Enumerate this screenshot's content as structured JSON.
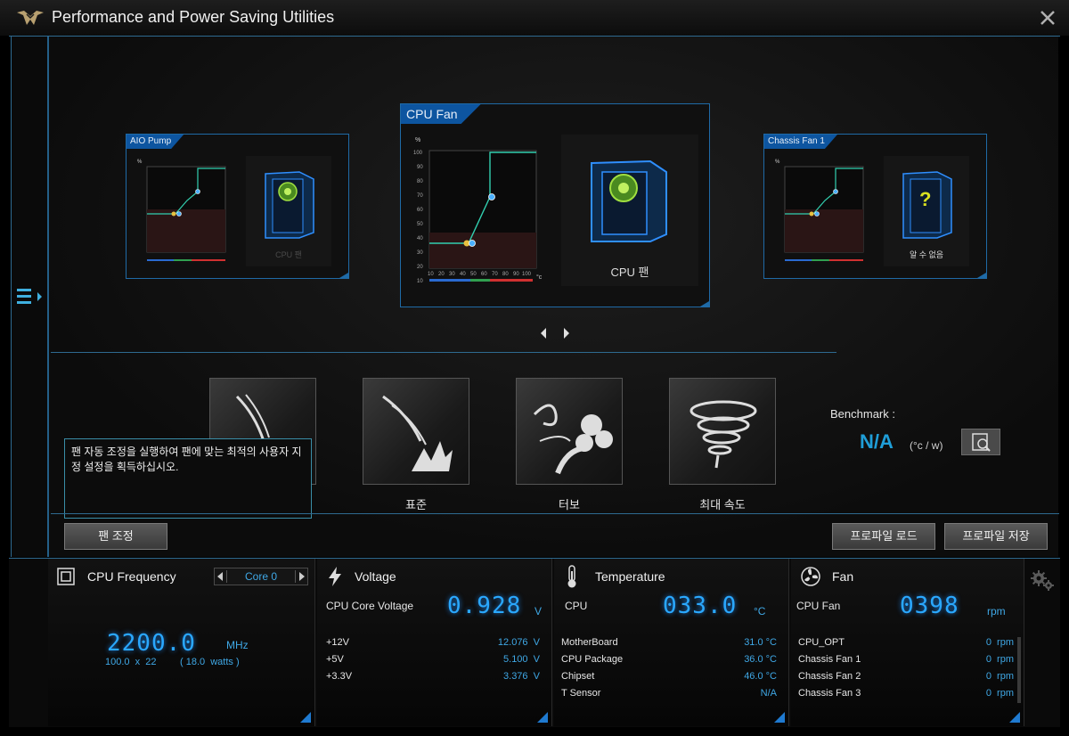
{
  "window": {
    "title": "Performance and Power Saving Utilities",
    "logo_icon": "tuf-logo-icon",
    "close_icon": "close-icon"
  },
  "sidebar": {
    "toggle_icon": "menu-expand-icon"
  },
  "fan_cards": {
    "left": {
      "name": "AIO Pump",
      "device_label": "CPU 팬"
    },
    "center": {
      "name": "CPU Fan",
      "device_label": "CPU 팬"
    },
    "right": {
      "name": "Chassis Fan 1",
      "device_label": "알 수 없음"
    },
    "chart": {
      "y_unit": "%",
      "x_unit": "°c",
      "y_ticks": [
        "100",
        "90",
        "80",
        "70",
        "60",
        "50",
        "40",
        "30",
        "20",
        "10"
      ],
      "x_ticks": [
        "10",
        "20",
        "30",
        "40",
        "50",
        "60",
        "70",
        "80",
        "90",
        "100"
      ]
    }
  },
  "navigation": {
    "prev_icon": "arrow-left-icon",
    "next_icon": "arrow-right-icon"
  },
  "modes": [
    {
      "label": "",
      "icon": "silent-mode-icon"
    },
    {
      "label": "표준",
      "icon": "standard-mode-icon"
    },
    {
      "label": "터보",
      "icon": "turbo-mode-icon"
    },
    {
      "label": "최대 속도",
      "icon": "full-speed-mode-icon"
    }
  ],
  "benchmark": {
    "label": "Benchmark :",
    "value": "N/A",
    "unit": "(°c / w)",
    "icon": "benchmark-search-icon"
  },
  "tooltip": {
    "text": "팬 자동 조정을 실행하여 팬에 맞는 최적의 사용자 지정 설정을 획득하십시오."
  },
  "buttons": {
    "fan_tuning": "팬 조정",
    "load_profile": "프로파일 로드",
    "save_profile": "프로파일 저장"
  },
  "cpu_frequency": {
    "title": "CPU Frequency",
    "selected_core": "Core 0",
    "value": "2200.0",
    "unit": "MHz",
    "multiplier": "100.0  x  22",
    "watts": "( 18.0  watts )"
  },
  "voltage": {
    "title": "Voltage",
    "main_label": "CPU Core Voltage",
    "main_value": "0.928",
    "main_unit": "V",
    "rows": [
      {
        "label": "+12V",
        "value": "12.076  V"
      },
      {
        "label": "+5V",
        "value": "5.100  V"
      },
      {
        "label": "+3.3V",
        "value": "3.376  V"
      }
    ]
  },
  "temperature": {
    "title": "Temperature",
    "main_label": "CPU",
    "main_value": "033.0",
    "main_unit": "°C",
    "rows": [
      {
        "label": "MotherBoard",
        "value": "31.0 °C"
      },
      {
        "label": "CPU Package",
        "value": "36.0 °C"
      },
      {
        "label": "Chipset",
        "value": "46.0 °C"
      },
      {
        "label": "T Sensor",
        "value": "N/A"
      }
    ]
  },
  "fan": {
    "title": "Fan",
    "main_label": "CPU Fan",
    "main_value": "0398",
    "main_unit": "rpm",
    "rows": [
      {
        "label": "CPU_OPT",
        "value": "0  rpm"
      },
      {
        "label": "Chassis Fan 1",
        "value": "0  rpm"
      },
      {
        "label": "Chassis Fan 2",
        "value": "0  rpm"
      },
      {
        "label": "Chassis Fan 3",
        "value": "0  rpm"
      }
    ]
  },
  "colors": {
    "accent_blue": "#1f9ed8",
    "border_blue": "#1f6aa6",
    "curve": "#32d0b0"
  }
}
